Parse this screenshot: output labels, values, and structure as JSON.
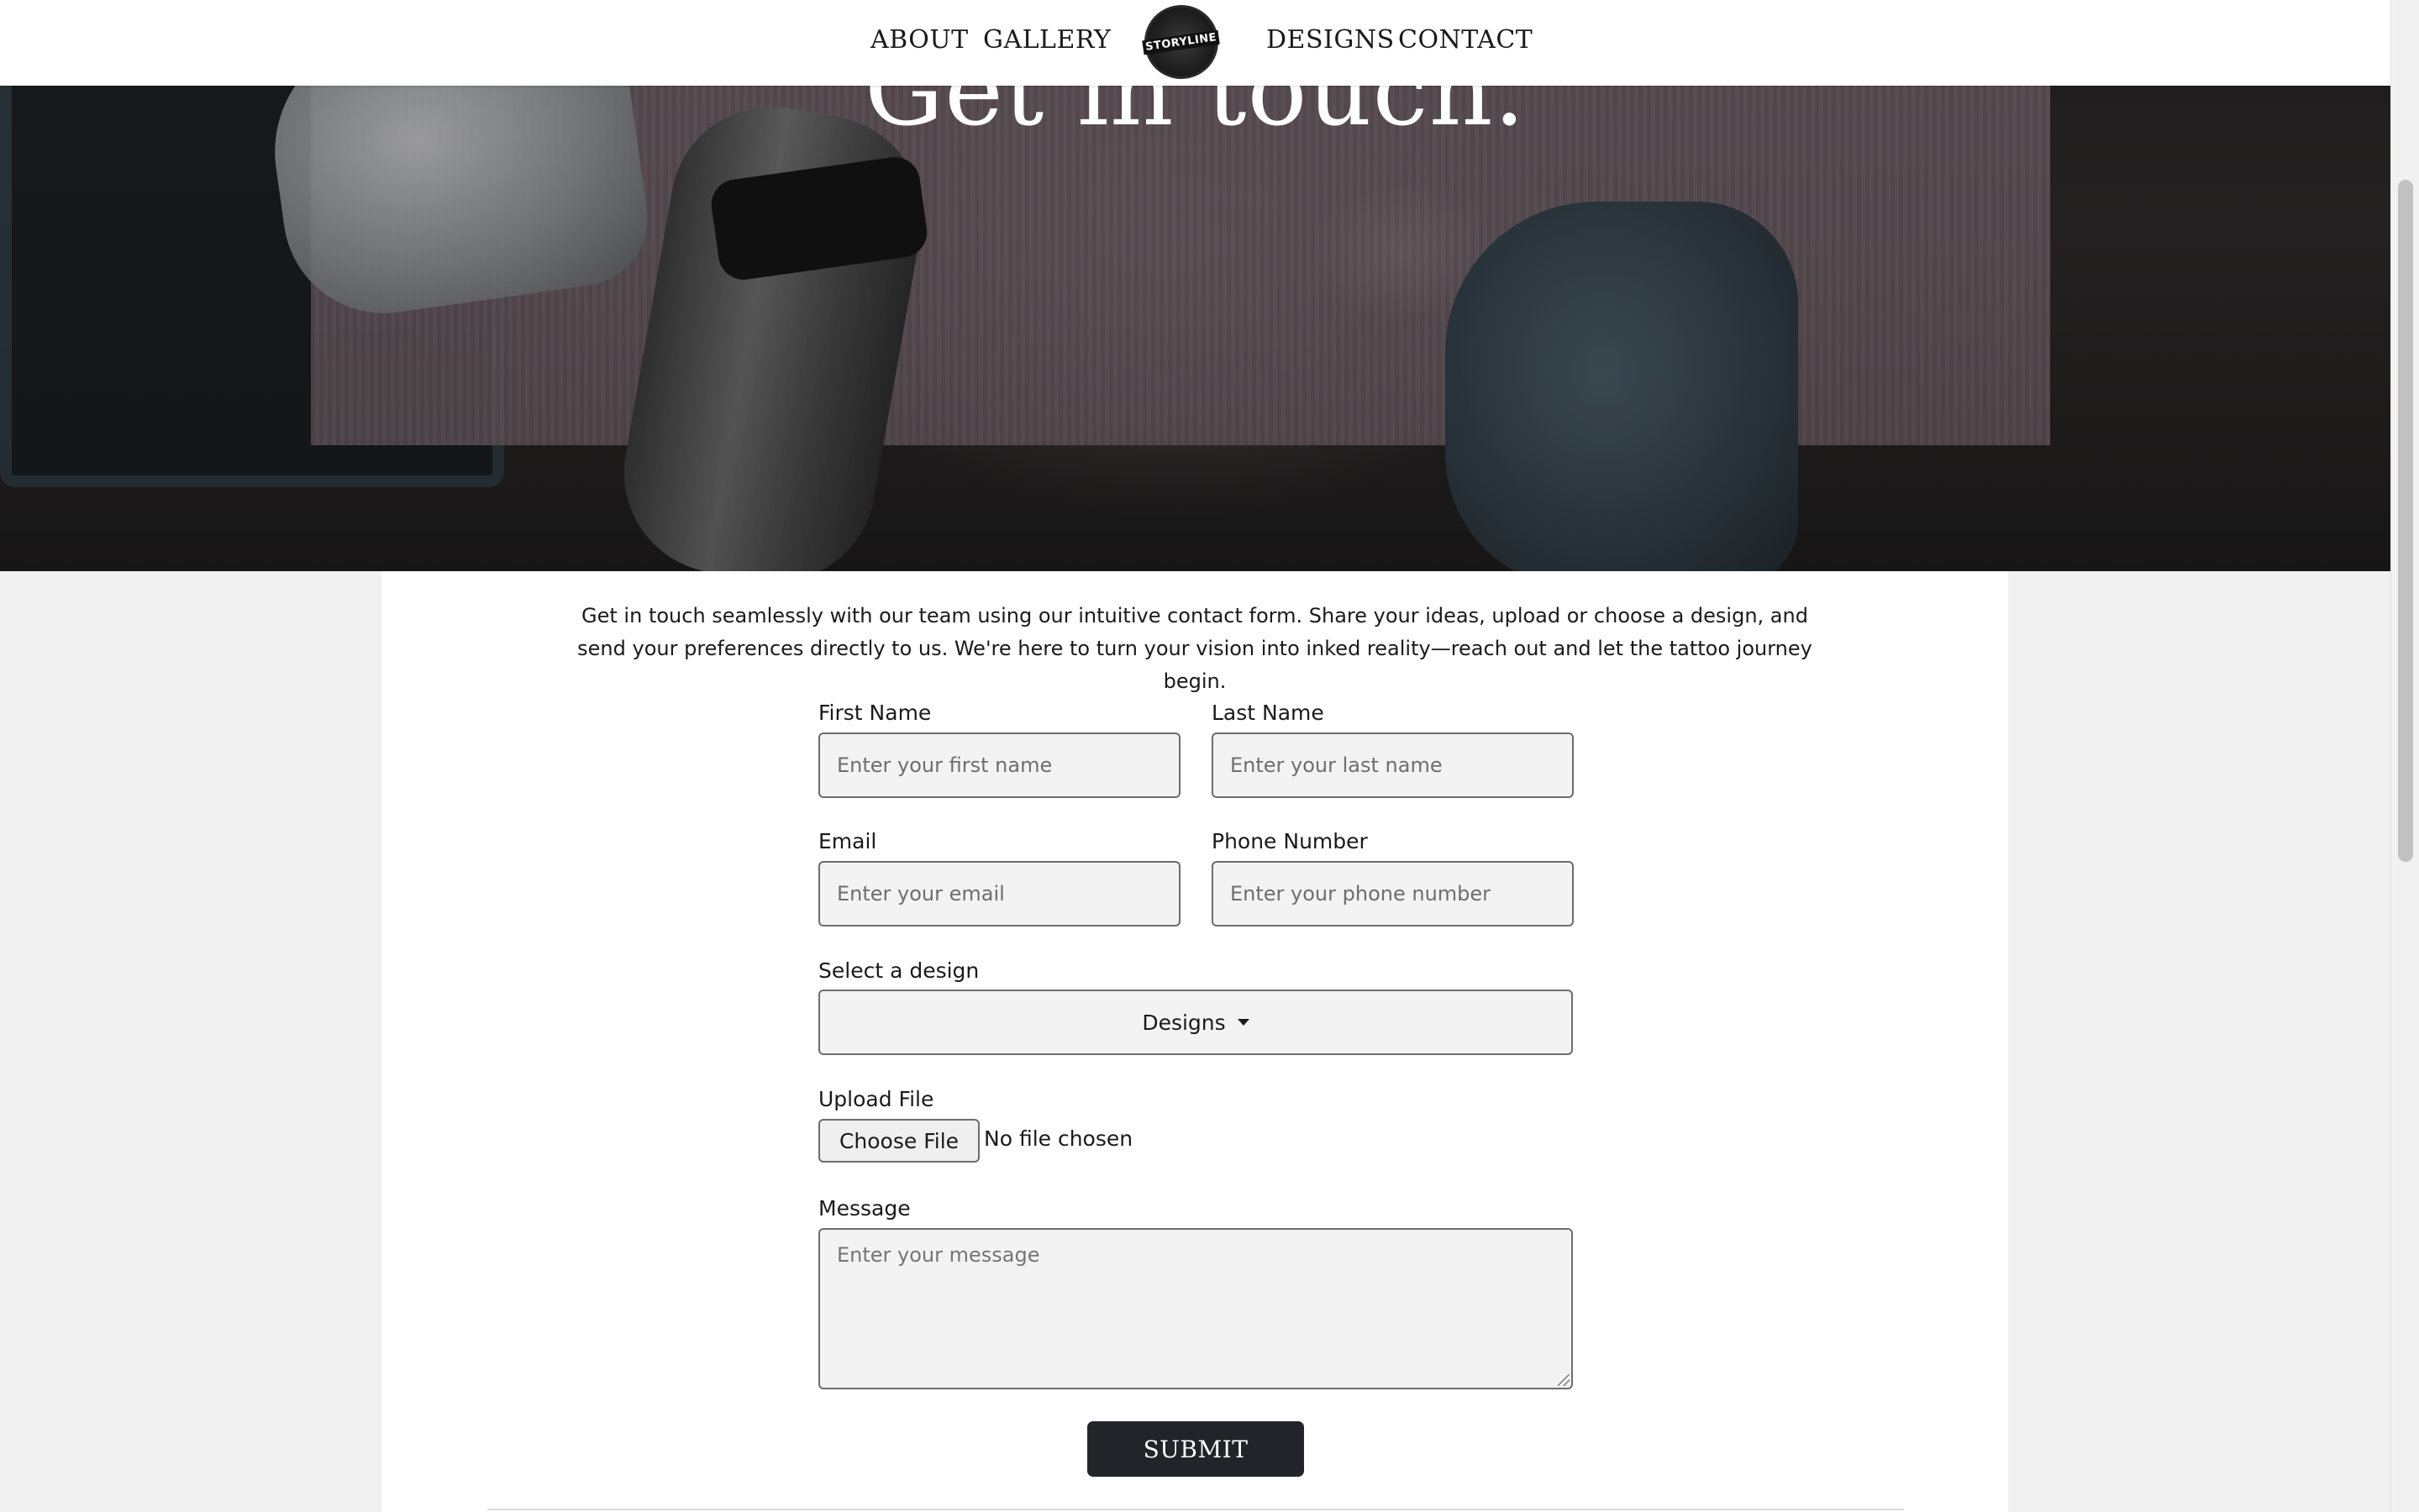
{
  "nav": {
    "about": "ABOUT",
    "gallery": "GALLERY",
    "logo_text": "STORYLINE",
    "designs": "DESIGNS",
    "contact": "CONTACT"
  },
  "hero": {
    "title": "Get in touch."
  },
  "intro": "Get in touch seamlessly with our team using our intuitive contact form. Share your ideas, upload or choose a design, and send your preferences directly to us. We're here to turn your vision into inked reality—reach out and let the tattoo journey begin.",
  "form": {
    "first_name": {
      "label": "First Name",
      "placeholder": "Enter your first name"
    },
    "last_name": {
      "label": "Last Name",
      "placeholder": "Enter your last name"
    },
    "email": {
      "label": "Email",
      "placeholder": "Enter your email"
    },
    "phone": {
      "label": "Phone Number",
      "placeholder": "Enter your phone number"
    },
    "design": {
      "label": "Select a design",
      "button": "Designs"
    },
    "upload": {
      "label": "Upload File",
      "button": "Choose File",
      "status": "No file chosen"
    },
    "message": {
      "label": "Message",
      "placeholder": "Enter your message"
    },
    "submit": "SUBMIT"
  },
  "colors": {
    "navbar_bg": "#ffffff",
    "page_bg": "#f1f1f1",
    "submit_bg": "#212529",
    "field_bg": "#f3f3f3"
  }
}
